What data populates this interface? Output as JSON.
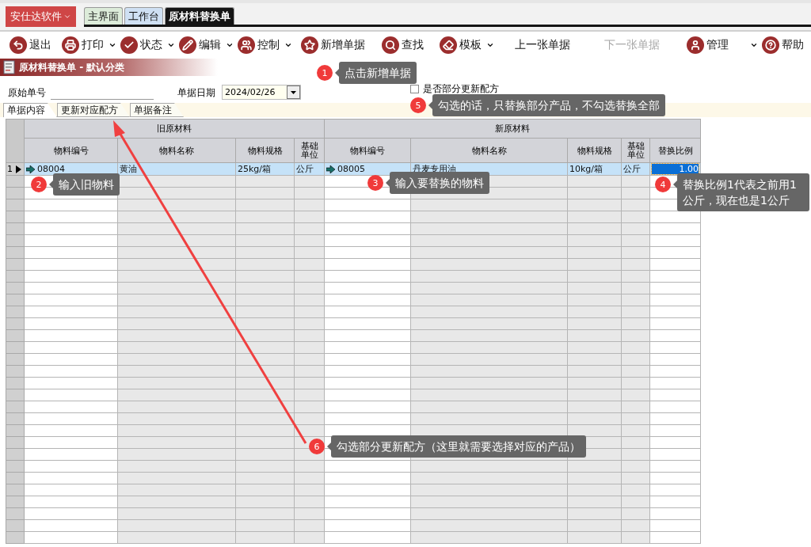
{
  "app_menu": {
    "label": "安仕达软件"
  },
  "top_tabs": [
    {
      "label": "主界面",
      "selected": false,
      "color": "#dcebd9"
    },
    {
      "label": "工作台",
      "selected": false,
      "color": "#cfe0f3"
    },
    {
      "label": "原材料替换单",
      "selected": true,
      "color": "#151515"
    }
  ],
  "toolbar": [
    {
      "label": "退出",
      "dropdown": false,
      "disabled": false
    },
    {
      "label": "打印",
      "dropdown": true,
      "disabled": false
    },
    {
      "label": "状态",
      "dropdown": true,
      "disabled": false
    },
    {
      "label": "编辑",
      "dropdown": true,
      "disabled": false
    },
    {
      "label": "控制",
      "dropdown": true,
      "disabled": false
    },
    {
      "label": "新增单据",
      "dropdown": false,
      "disabled": false
    },
    {
      "label": "查找",
      "dropdown": false,
      "disabled": false
    },
    {
      "label": "模板",
      "dropdown": true,
      "disabled": false
    },
    {
      "label": "上一张单据",
      "dropdown": false,
      "disabled": false
    },
    {
      "label": "下一张单据",
      "dropdown": false,
      "disabled": true
    },
    {
      "label": "管理",
      "dropdown": true,
      "disabled": false
    },
    {
      "label": "帮助",
      "dropdown": false,
      "disabled": false
    }
  ],
  "form_title": "原材料替换单 - 默认分类",
  "fields": {
    "source_no": {
      "label": "原始单号"
    },
    "date": {
      "label": "单据日期",
      "value": "2024/02/26"
    },
    "partial_update": {
      "label": "是否部分更新配方",
      "checked": false
    }
  },
  "doc_tabs": [
    {
      "label": "单据内容",
      "selected": true
    },
    {
      "label": "更新对应配方",
      "selected": false
    },
    {
      "label": "单据备注",
      "selected": false
    }
  ],
  "grid": {
    "groups": [
      {
        "label": "旧原材料",
        "columns": [
          {
            "label": "物料编号",
            "editable": true
          },
          {
            "label": "物料名称",
            "editable": false
          },
          {
            "label": "物料规格",
            "editable": false
          },
          {
            "label": "基础单位",
            "editable": false
          }
        ]
      },
      {
        "label": "新原材料",
        "columns": [
          {
            "label": "物料编号",
            "editable": true
          },
          {
            "label": "物料名称",
            "editable": false
          },
          {
            "label": "物料规格",
            "editable": false
          },
          {
            "label": "基础单位",
            "editable": false
          },
          {
            "label": "替换比例",
            "editable": true
          }
        ]
      }
    ],
    "rows": [
      {
        "number": "1",
        "current": true,
        "cells": [
          {
            "text": "08004",
            "lookup": true,
            "selected": false
          },
          {
            "text": "黄油",
            "lookup": false,
            "selected": false
          },
          {
            "text": "25kg/箱",
            "lookup": false,
            "selected": false
          },
          {
            "text": "公斤",
            "lookup": false,
            "selected": false
          },
          {
            "text": "08005",
            "lookup": true,
            "selected": false
          },
          {
            "text": "丹麦专用油",
            "lookup": false,
            "selected": false
          },
          {
            "text": "10kg/箱",
            "lookup": false,
            "selected": false
          },
          {
            "text": "公斤",
            "lookup": false,
            "selected": false
          },
          {
            "text": "1.00",
            "lookup": false,
            "selected": true
          }
        ]
      }
    ]
  },
  "callouts": [
    {
      "number": "1",
      "text": "点击新增单据"
    },
    {
      "number": "2",
      "text": "输入旧物料"
    },
    {
      "number": "3",
      "text": "输入要替换的物料"
    },
    {
      "number": "4",
      "text": "替换比例1代表之前用1公斤，现在也是1公斤"
    },
    {
      "number": "5",
      "text": "勾选的话，只替换部分产品，不勾选替换全部"
    },
    {
      "number": "6",
      "text": "勾选部分更新配方（这里就需要选择对应的产品）"
    }
  ]
}
